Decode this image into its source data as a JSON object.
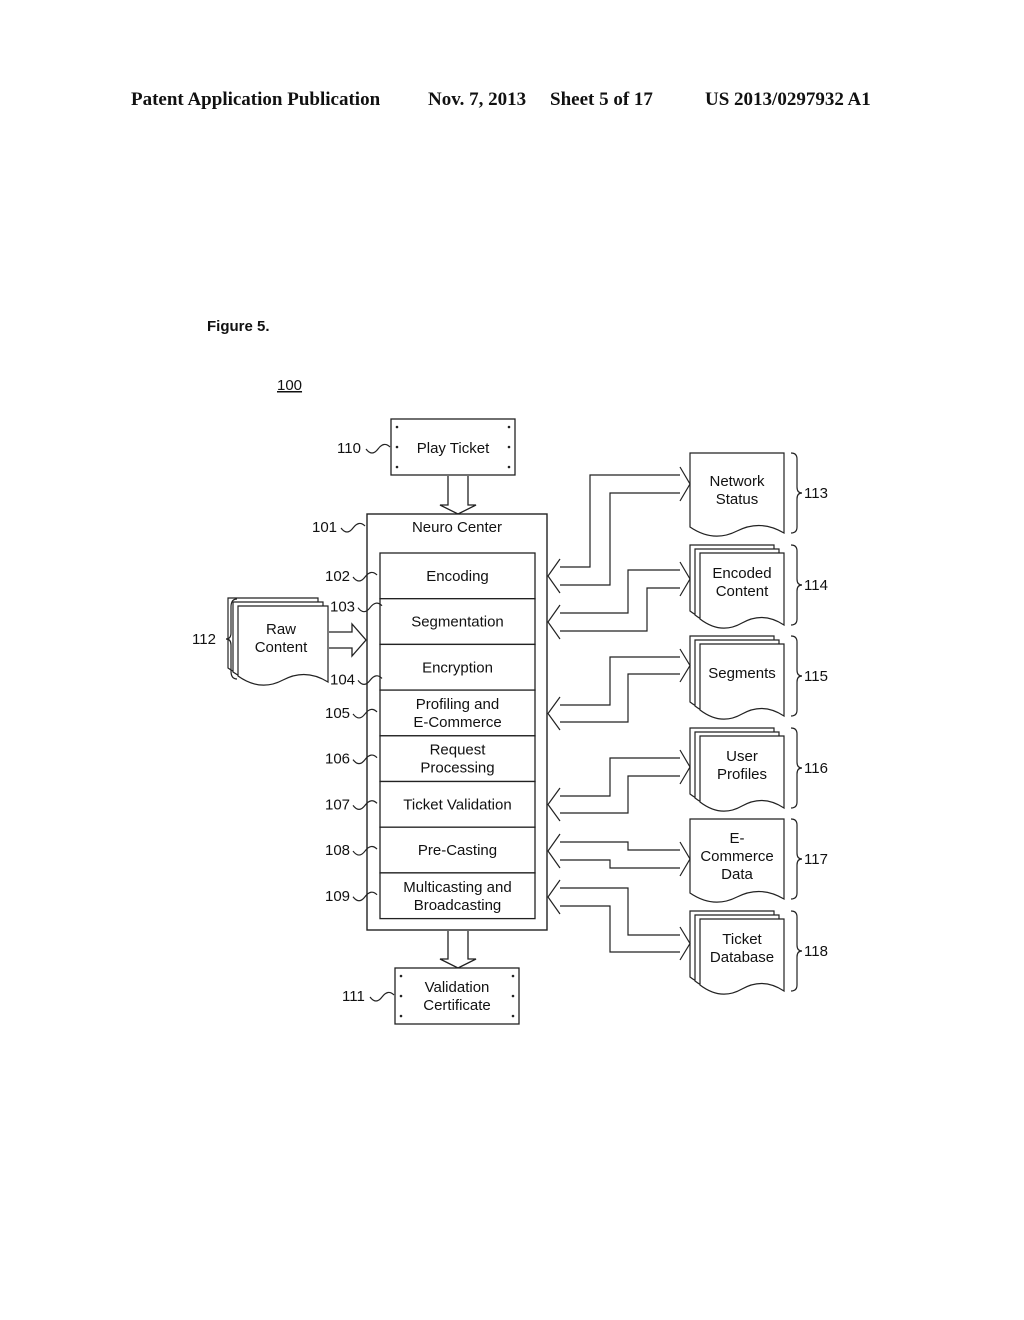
{
  "header": {
    "publication": "Patent Application Publication",
    "date": "Nov. 7, 2013",
    "sheet": "Sheet 5 of 17",
    "patent_number": "US 2013/0297932 A1"
  },
  "figure": {
    "label": "Figure 5.",
    "system_ref": "100"
  },
  "play_ticket": {
    "ref": "110",
    "label": "Play Ticket"
  },
  "validation_certificate": {
    "ref": "111",
    "lines": [
      "Validation",
      "Certificate"
    ]
  },
  "neuro_center": {
    "ref": "101",
    "title": "Neuro Center",
    "modules": [
      {
        "ref": "102",
        "lines": [
          "Encoding"
        ]
      },
      {
        "ref": "103",
        "lines": [
          "Segmentation"
        ]
      },
      {
        "ref": "104",
        "lines": [
          "Encryption"
        ]
      },
      {
        "ref": "105",
        "lines": [
          "Profiling and",
          "E-Commerce"
        ]
      },
      {
        "ref": "106",
        "lines": [
          "Request",
          "Processing"
        ]
      },
      {
        "ref": "107",
        "lines": [
          "Ticket Validation"
        ]
      },
      {
        "ref": "108",
        "lines": [
          "Pre-Casting"
        ]
      },
      {
        "ref": "109",
        "lines": [
          "Multicasting and",
          "Broadcasting"
        ]
      }
    ]
  },
  "raw_content": {
    "ref": "112",
    "lines": [
      "Raw",
      "Content"
    ]
  },
  "data_stores": [
    {
      "ref": "113",
      "lines": [
        "Network",
        "Status"
      ],
      "stacked": false
    },
    {
      "ref": "114",
      "lines": [
        "Encoded",
        "Content"
      ],
      "stacked": true
    },
    {
      "ref": "115",
      "lines": [
        "Segments"
      ],
      "stacked": true
    },
    {
      "ref": "116",
      "lines": [
        "User",
        "Profiles"
      ],
      "stacked": true
    },
    {
      "ref": "117",
      "lines": [
        "E-",
        "Commerce",
        "Data"
      ],
      "stacked": false
    },
    {
      "ref": "118",
      "lines": [
        "Ticket",
        "Database"
      ],
      "stacked": true
    }
  ]
}
